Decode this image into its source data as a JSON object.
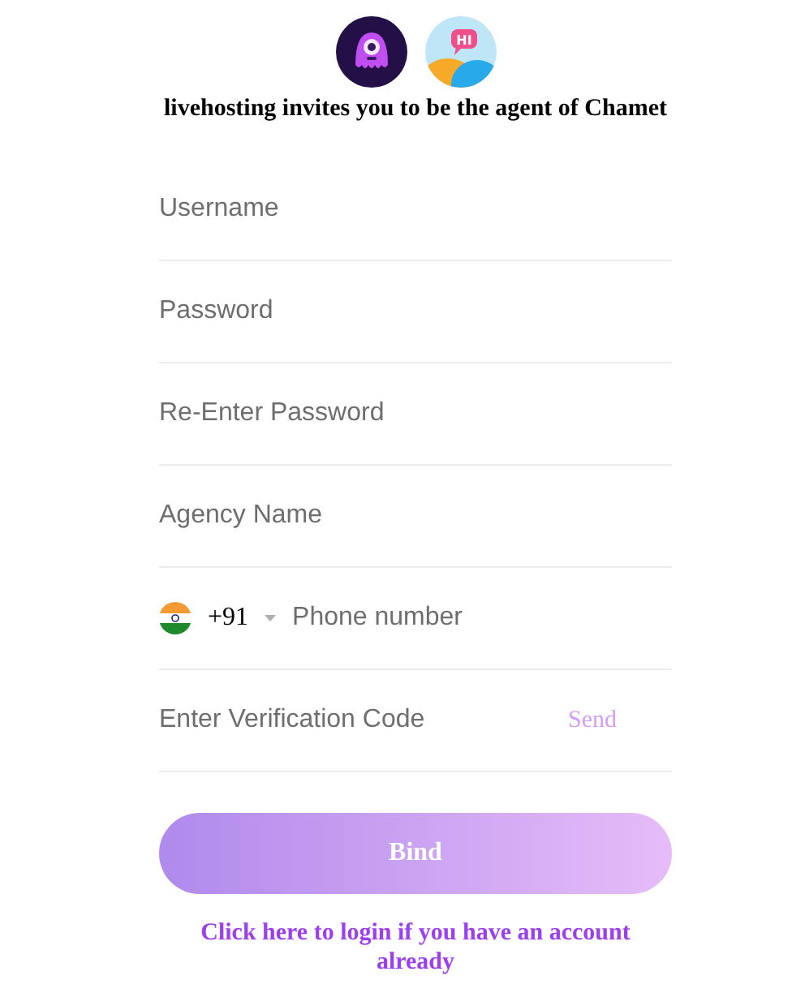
{
  "header": {
    "logos": [
      {
        "kind": "octopus"
      },
      {
        "kind": "chat",
        "badge": "HI"
      }
    ],
    "title": "livehosting invites you to be the agent of Chamet"
  },
  "fields": [
    {
      "kind": "text",
      "placeholder": "Username"
    },
    {
      "kind": "text",
      "placeholder": "Password"
    },
    {
      "kind": "text",
      "placeholder": "Re-Enter Password"
    },
    {
      "kind": "text",
      "placeholder": "Agency Name"
    },
    {
      "kind": "phone",
      "country_code": "+91",
      "placeholder": "Phone number"
    },
    {
      "kind": "code",
      "placeholder": "Enter Verification Code",
      "action": "Send"
    }
  ],
  "bind_button": "Bind",
  "login_link": "Click here to login if you have an account already"
}
